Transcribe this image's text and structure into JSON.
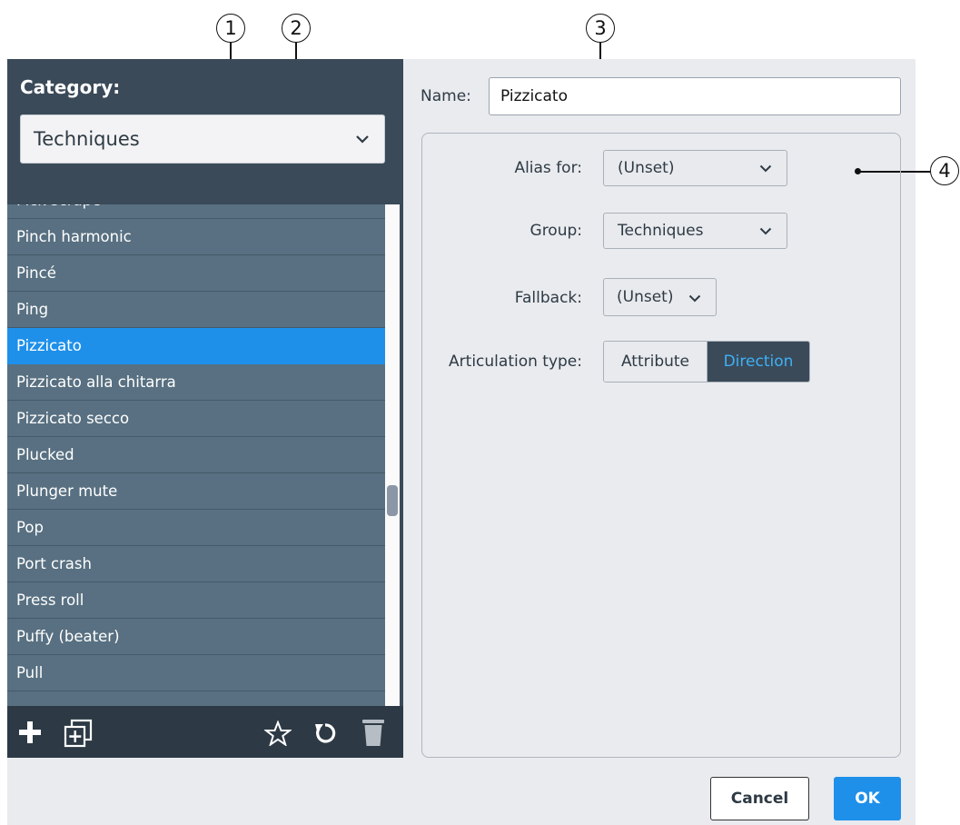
{
  "callouts": [
    "1",
    "2",
    "3",
    "4"
  ],
  "category": {
    "label": "Category:",
    "selected": "Techniques",
    "icon": "chevron-down-icon"
  },
  "list": {
    "items": [
      "Pick scrape",
      "Pinch harmonic",
      "Pincé",
      "Ping",
      "Pizzicato",
      "Pizzicato alla chitarra",
      "Pizzicato secco",
      "Plucked",
      "Plunger mute",
      "Pop",
      "Port crash",
      "Press roll",
      "Puffy (beater)",
      "Pull"
    ],
    "selected": "Pizzicato"
  },
  "toolbar": {
    "icons": [
      "add-icon",
      "duplicate-icon",
      "star-icon",
      "reset-icon",
      "trash-icon"
    ]
  },
  "name": {
    "label": "Name:",
    "value": "Pizzicato"
  },
  "properties": {
    "alias_label": "Alias for:",
    "alias_value": "(Unset)",
    "group_label": "Group:",
    "group_value": "Techniques",
    "fallback_label": "Fallback:",
    "fallback_value": "(Unset)",
    "articulation_label": "Articulation type:",
    "articulation_options": [
      "Attribute",
      "Direction"
    ],
    "articulation_selected": "Direction"
  },
  "buttons": {
    "cancel": "Cancel",
    "ok": "OK"
  },
  "colors": {
    "panel_dark": "#3a4a59",
    "list_row": "#587081",
    "selected_row": "#1e90ea",
    "accent_text": "#3fb0f5",
    "dialog_bg": "#e9ebef"
  }
}
